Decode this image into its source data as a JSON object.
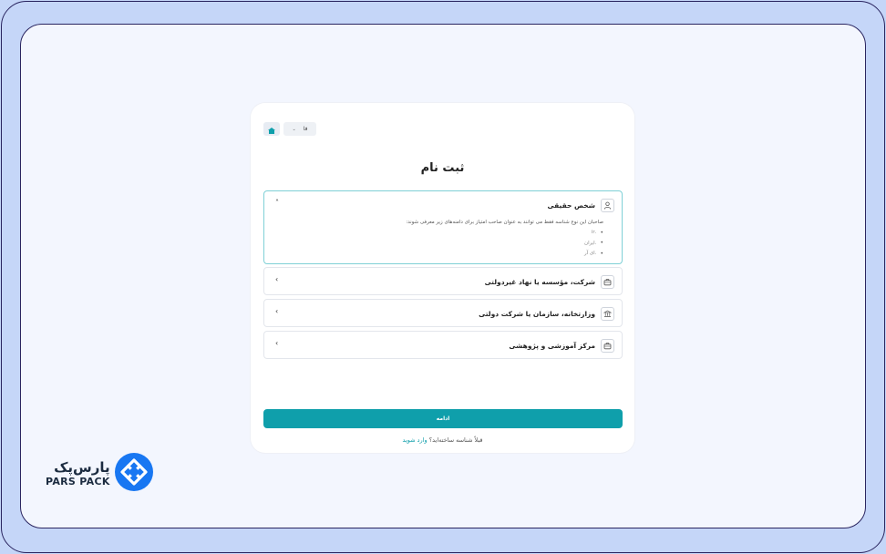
{
  "topbar": {
    "lang": "فا"
  },
  "page_title": "ثبت نام",
  "accordion": [
    {
      "label": "شخص حقیقی",
      "icon": "user-icon",
      "open": true,
      "description": "صاحبان این نوع شناسه فقط می توانند به عنوان صاحب امتیاز برای دامنه‌های زیر معرفی شوند:",
      "items": [
        ".ir",
        ".ایران",
        ".ای آر"
      ]
    },
    {
      "label": "شرکت، مؤسسه یا نهاد غیردولتی",
      "icon": "briefcase-icon",
      "open": false
    },
    {
      "label": "وزارتخانه، سازمان یا شرکت دولتی",
      "icon": "bank-icon",
      "open": false
    },
    {
      "label": "مرکز آموزشی و پژوهشی",
      "icon": "briefcase-icon",
      "open": false
    }
  ],
  "submit_label": "ادامه",
  "login": {
    "question": "قبلاً شناسه ساخته‌اید؟",
    "link": "وارد شوید"
  },
  "brand": {
    "name_fa": "پارس‌پک",
    "name_en": "PARS PACK",
    "color": "#1877f2"
  }
}
